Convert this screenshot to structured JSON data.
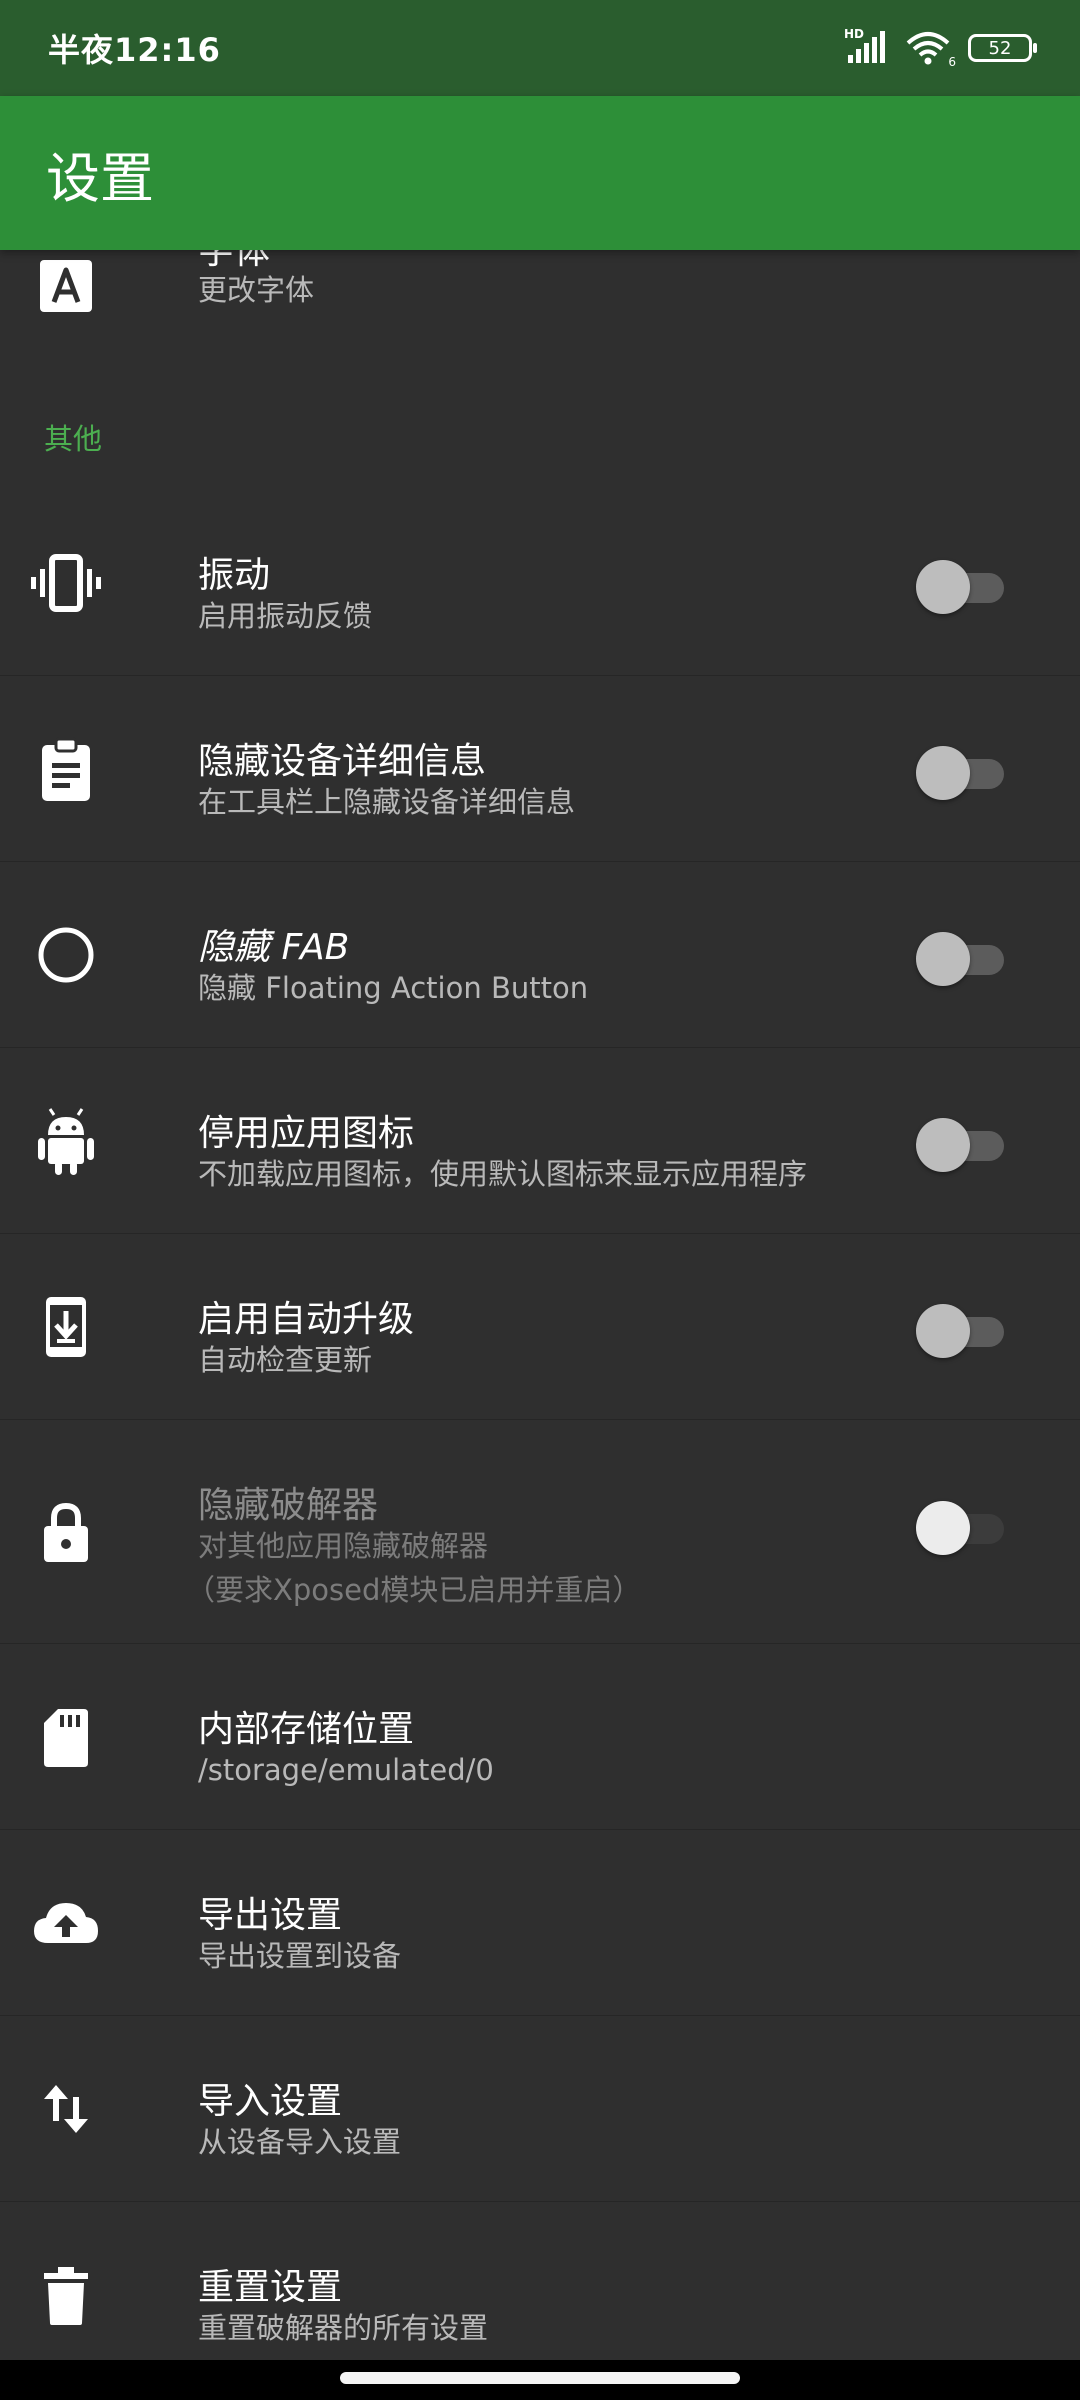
{
  "status_bar": {
    "time": "半夜12:16",
    "signal_label": "HD",
    "wifi_label": "6",
    "battery": "52"
  },
  "app_bar": {
    "title": "设置"
  },
  "partial_item": {
    "title": "字体",
    "subtitle": "更改字体",
    "icon": "font-icon"
  },
  "section": {
    "label": "其他",
    "accent_color": "#4caf50"
  },
  "items": [
    {
      "title": "振动",
      "subtitle": "启用振动反馈",
      "icon": "vibration-icon",
      "toggle": false
    },
    {
      "title": "隐藏设备详细信息",
      "subtitle": "在工具栏上隐藏设备详细信息",
      "icon": "clipboard-icon",
      "toggle": false
    },
    {
      "title": "隐藏 FAB",
      "subtitle": "隐藏 Floating Action Button",
      "icon": "circle-icon",
      "toggle": false
    },
    {
      "title": "停用应用图标",
      "subtitle": "不加载应用图标，使用默认图标来显示应用程序",
      "icon": "android-icon",
      "toggle": false
    },
    {
      "title": "启用自动升级",
      "subtitle": "自动检查更新",
      "icon": "system-update-icon",
      "toggle": false
    },
    {
      "title": "隐藏破解器",
      "subtitle": "对其他应用隐藏破解器",
      "subtitle2": "（要求Xposed模块已启用并重启）",
      "icon": "lock-icon",
      "toggle": false,
      "disabled": true
    },
    {
      "title": "内部存储位置",
      "subtitle": "/storage/emulated/0",
      "icon": "sd-card-icon"
    },
    {
      "title": "导出设置",
      "subtitle": "导出设置到设备",
      "icon": "cloud-upload-icon"
    },
    {
      "title": "导入设置",
      "subtitle": "从设备导入设置",
      "icon": "swap-vert-icon"
    },
    {
      "title": "重置设置",
      "subtitle": "重置破解器的所有设置",
      "icon": "trash-icon"
    }
  ],
  "colors": {
    "status_bar": "#2a5d2e",
    "app_bar": "#2d8f38",
    "background": "#2f2f2f"
  }
}
